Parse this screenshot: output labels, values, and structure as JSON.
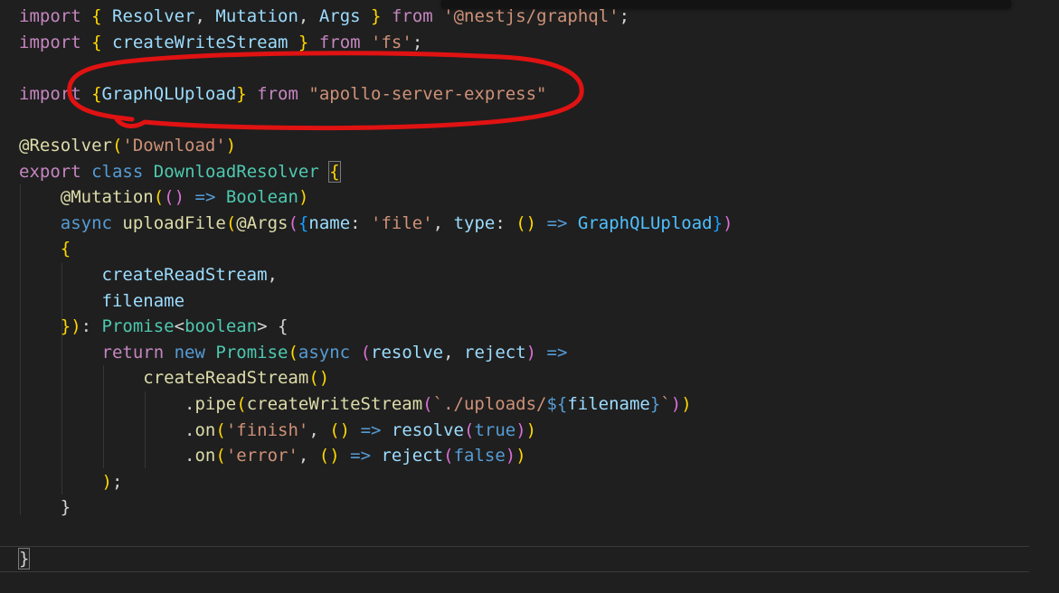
{
  "editor": {
    "description": "Dark code editor showing a NestJS GraphQL upload resolver in TypeScript",
    "background": "#1f1f1f",
    "colors": {
      "k": "#C586C0",
      "st": "#569CD6",
      "v": "#9CDCFE",
      "f": "#DCDCAA",
      "cl": "#4EC9B0",
      "s": "#CE9178",
      "p": "#D4D4D4",
      "b1": "#FFD700",
      "b2": "#DA70D6",
      "b3": "#179FFF",
      "cn": "#4FC1FF"
    },
    "color_key_legend": {
      "k": "keyword-magenta",
      "st": "storage-control-blue",
      "v": "variable-lightblue",
      "f": "function-yellow",
      "cl": "class-type-teal",
      "s": "string-orange",
      "p": "punctuation-white",
      "b1": "bracket-level-gold",
      "b2": "bracket-level-pink",
      "b3": "bracket-level-blue",
      "cn": "constant-brightblue"
    },
    "lines": [
      {
        "text": "import { Resolver, Mutation, Args } from '@nestjs/graphql';",
        "spans": [
          [
            "k",
            "import"
          ],
          [
            "p",
            " "
          ],
          [
            "b1",
            "{"
          ],
          [
            "p",
            " "
          ],
          [
            "v",
            "Resolver"
          ],
          [
            "p",
            ", "
          ],
          [
            "v",
            "Mutation"
          ],
          [
            "p",
            ", "
          ],
          [
            "v",
            "Args"
          ],
          [
            "p",
            " "
          ],
          [
            "b1",
            "}"
          ],
          [
            "p",
            " "
          ],
          [
            "k",
            "from"
          ],
          [
            "p",
            " "
          ],
          [
            "s",
            "'@nestjs/graphql'"
          ],
          [
            "p",
            ";"
          ]
        ]
      },
      {
        "text": "import { createWriteStream } from 'fs';",
        "spans": [
          [
            "k",
            "import"
          ],
          [
            "p",
            " "
          ],
          [
            "b1",
            "{"
          ],
          [
            "p",
            " "
          ],
          [
            "v",
            "createWriteStream"
          ],
          [
            "p",
            " "
          ],
          [
            "b1",
            "}"
          ],
          [
            "p",
            " "
          ],
          [
            "k",
            "from"
          ],
          [
            "p",
            " "
          ],
          [
            "s",
            "'fs'"
          ],
          [
            "p",
            ";"
          ]
        ]
      },
      {
        "text": "",
        "spans": []
      },
      {
        "text": "import {GraphQLUpload} from \"apollo-server-express\"",
        "spans": [
          [
            "k",
            "import"
          ],
          [
            "p",
            " "
          ],
          [
            "b1",
            "{"
          ],
          [
            "v",
            "GraphQLUpload"
          ],
          [
            "b1",
            "}"
          ],
          [
            "p",
            " "
          ],
          [
            "k",
            "from"
          ],
          [
            "p",
            " "
          ],
          [
            "s",
            "\"apollo-server-express\""
          ]
        ]
      },
      {
        "text": "",
        "spans": []
      },
      {
        "text": "@Resolver('Download')",
        "spans": [
          [
            "f",
            "@Resolver"
          ],
          [
            "b1",
            "("
          ],
          [
            "s",
            "'Download'"
          ],
          [
            "b1",
            ")"
          ]
        ]
      },
      {
        "text": "export class DownloadResolver {",
        "spans": [
          [
            "k",
            "export"
          ],
          [
            "p",
            " "
          ],
          [
            "st",
            "class"
          ],
          [
            "p",
            " "
          ],
          [
            "cl",
            "DownloadResolver"
          ],
          [
            "p",
            " "
          ],
          [
            "b1",
            "{",
            "box"
          ]
        ]
      },
      {
        "text": "    @Mutation(() => Boolean)",
        "spans": [
          [
            "p",
            "    "
          ],
          [
            "f",
            "@Mutation"
          ],
          [
            "b1",
            "("
          ],
          [
            "b2",
            "()"
          ],
          [
            "p",
            " "
          ],
          [
            "st",
            "=>"
          ],
          [
            "p",
            " "
          ],
          [
            "cl",
            "Boolean"
          ],
          [
            "b1",
            ")"
          ]
        ]
      },
      {
        "text": "    async uploadFile(@Args({name: 'file', type: () => GraphQLUpload})",
        "spans": [
          [
            "p",
            "    "
          ],
          [
            "st",
            "async"
          ],
          [
            "p",
            " "
          ],
          [
            "f",
            "uploadFile"
          ],
          [
            "b1",
            "("
          ],
          [
            "f",
            "@Args"
          ],
          [
            "b2",
            "("
          ],
          [
            "b3",
            "{"
          ],
          [
            "v",
            "name"
          ],
          [
            "p",
            ": "
          ],
          [
            "s",
            "'file'"
          ],
          [
            "p",
            ", "
          ],
          [
            "v",
            "type"
          ],
          [
            "p",
            ": "
          ],
          [
            "b1",
            "()"
          ],
          [
            "p",
            " "
          ],
          [
            "st",
            "=>"
          ],
          [
            "p",
            " "
          ],
          [
            "cn",
            "GraphQLUpload"
          ],
          [
            "b3",
            "}"
          ],
          [
            "b2",
            ")"
          ]
        ]
      },
      {
        "text": "    {",
        "spans": [
          [
            "p",
            "    "
          ],
          [
            "b1",
            "{"
          ]
        ]
      },
      {
        "text": "        createReadStream,",
        "spans": [
          [
            "p",
            "        "
          ],
          [
            "v",
            "createReadStream"
          ],
          [
            "p",
            ","
          ]
        ]
      },
      {
        "text": "        filename",
        "spans": [
          [
            "p",
            "        "
          ],
          [
            "v",
            "filename"
          ]
        ]
      },
      {
        "text": "    }): Promise<boolean> {",
        "spans": [
          [
            "p",
            "    "
          ],
          [
            "b1",
            "})"
          ],
          [
            "p",
            ": "
          ],
          [
            "cl",
            "Promise"
          ],
          [
            "p",
            "<"
          ],
          [
            "cl",
            "boolean"
          ],
          [
            "p",
            "> "
          ],
          [
            "p",
            "{"
          ]
        ]
      },
      {
        "text": "        return new Promise(async (resolve, reject) =>",
        "spans": [
          [
            "p",
            "        "
          ],
          [
            "k",
            "return"
          ],
          [
            "p",
            " "
          ],
          [
            "st",
            "new"
          ],
          [
            "p",
            " "
          ],
          [
            "cl",
            "Promise"
          ],
          [
            "b1",
            "("
          ],
          [
            "st",
            "async"
          ],
          [
            "p",
            " "
          ],
          [
            "b2",
            "("
          ],
          [
            "v",
            "resolve"
          ],
          [
            "p",
            ", "
          ],
          [
            "v",
            "reject"
          ],
          [
            "b2",
            ")"
          ],
          [
            "p",
            " "
          ],
          [
            "st",
            "=>"
          ]
        ]
      },
      {
        "text": "            createReadStream()",
        "spans": [
          [
            "p",
            "            "
          ],
          [
            "f",
            "createReadStream"
          ],
          [
            "b1",
            "()"
          ]
        ]
      },
      {
        "text": "                .pipe(createWriteStream(`./uploads/${filename}`))",
        "spans": [
          [
            "p",
            "                "
          ],
          [
            "p",
            "."
          ],
          [
            "f",
            "pipe"
          ],
          [
            "b1",
            "("
          ],
          [
            "f",
            "createWriteStream"
          ],
          [
            "b2",
            "("
          ],
          [
            "s",
            "`./uploads/"
          ],
          [
            "st",
            "${"
          ],
          [
            "v",
            "filename"
          ],
          [
            "st",
            "}"
          ],
          [
            "s",
            "`"
          ],
          [
            "b2",
            ")"
          ],
          [
            "b1",
            ")"
          ]
        ]
      },
      {
        "text": "                .on('finish', () => resolve(true))",
        "spans": [
          [
            "p",
            "                "
          ],
          [
            "p",
            "."
          ],
          [
            "f",
            "on"
          ],
          [
            "b1",
            "("
          ],
          [
            "s",
            "'finish'"
          ],
          [
            "p",
            ", "
          ],
          [
            "b1",
            "()"
          ],
          [
            "p",
            " "
          ],
          [
            "st",
            "=>"
          ],
          [
            "p",
            " "
          ],
          [
            "v",
            "resolve"
          ],
          [
            "b2",
            "("
          ],
          [
            "st",
            "true"
          ],
          [
            "b2",
            ")"
          ],
          [
            "b1",
            ")"
          ]
        ]
      },
      {
        "text": "                .on('error', () => reject(false))",
        "spans": [
          [
            "p",
            "                "
          ],
          [
            "p",
            "."
          ],
          [
            "f",
            "on"
          ],
          [
            "b1",
            "("
          ],
          [
            "s",
            "'error'"
          ],
          [
            "p",
            ", "
          ],
          [
            "b1",
            "()"
          ],
          [
            "p",
            " "
          ],
          [
            "st",
            "=>"
          ],
          [
            "p",
            " "
          ],
          [
            "v",
            "reject"
          ],
          [
            "b2",
            "("
          ],
          [
            "st",
            "false"
          ],
          [
            "b2",
            ")"
          ],
          [
            "b1",
            ")"
          ]
        ]
      },
      {
        "text": "        );",
        "spans": [
          [
            "p",
            "        "
          ],
          [
            "b1",
            ")"
          ],
          [
            "p",
            ";"
          ]
        ]
      },
      {
        "text": "    }",
        "spans": [
          [
            "p",
            "    "
          ],
          [
            "p",
            "}"
          ]
        ]
      },
      {
        "text": "",
        "spans": []
      },
      {
        "text": "}",
        "current": true,
        "spans": [
          [
            "p",
            "}",
            "box"
          ]
        ]
      }
    ],
    "annotation": {
      "shape": "hand-drawn red ellipse",
      "color": "#E01212",
      "around_text": "import {GraphQLUpload} from \"apollo-server-express\"",
      "around_line_number": 4
    }
  }
}
